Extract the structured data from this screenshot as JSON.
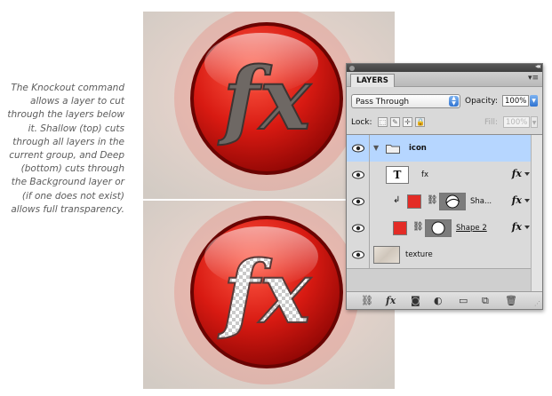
{
  "caption": "The Knockout command allows a layer to cut through the layers below it. Shallow (top) cuts through all layers in the current group, and Deep (bottom) cuts through the Background layer or (if one does not exist) allows full transparency.",
  "artwork": {
    "top_label": "fx",
    "bottom_label": "fx"
  },
  "panel": {
    "tab": "LAYERS",
    "blend_mode": "Pass Through",
    "opacity_label": "Opacity:",
    "opacity_value": "100%",
    "lock_label": "Lock:",
    "fill_label": "Fill:",
    "fill_value": "100%",
    "layers": [
      {
        "name": "icon",
        "type": "group",
        "selected": true
      },
      {
        "name": "fx",
        "type": "text",
        "thumb": "T",
        "has_fx": true
      },
      {
        "name": "Sha...",
        "type": "shape",
        "clipped": true,
        "has_fx": true
      },
      {
        "name": "Shape 2",
        "type": "shape",
        "has_fx": true
      },
      {
        "name": "texture",
        "type": "image"
      }
    ],
    "fx_symbol": "fx",
    "colors": {
      "accent_red": "#e32c26",
      "selection": "#b6d6ff",
      "stepper_blue": "#2f73d1"
    }
  }
}
